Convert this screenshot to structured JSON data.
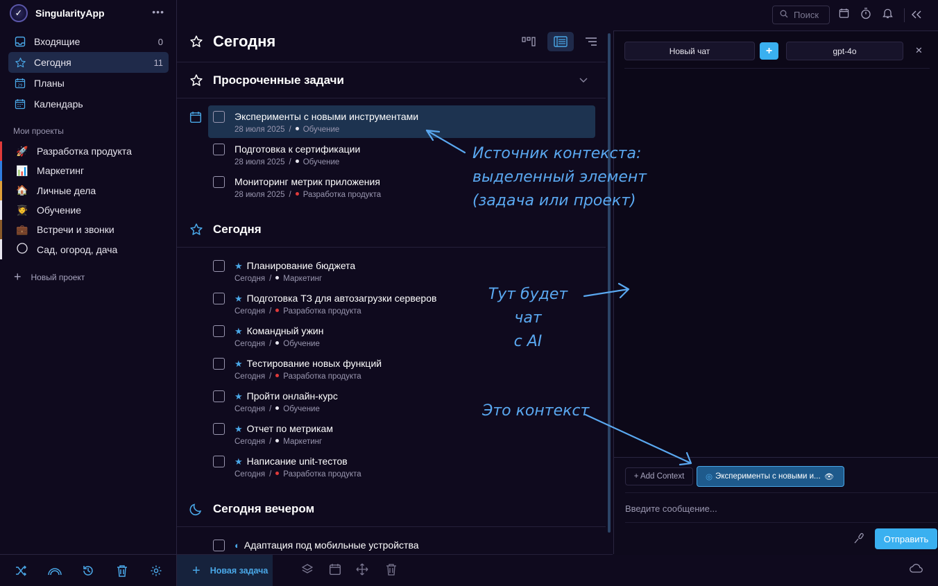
{
  "app": {
    "title": "SingularityApp",
    "more": "•••"
  },
  "nav": [
    {
      "label": "Входящие",
      "count": "0",
      "icon": "inbox-icon"
    },
    {
      "label": "Сегодня",
      "count": "11",
      "icon": "star-icon"
    },
    {
      "label": "Планы",
      "count": "",
      "icon": "plans-calendar-icon"
    },
    {
      "label": "Календарь",
      "count": "",
      "icon": "calendar-icon"
    }
  ],
  "projects_label": "Мои проекты",
  "projects": [
    {
      "label": "Разработка продукта",
      "emoji": "🚀",
      "color": "#e03a3a"
    },
    {
      "label": "Маркетинг",
      "emoji": "📊",
      "color": "#2f7de0"
    },
    {
      "label": "Личные дела",
      "emoji": "🏠",
      "color": "#e0a03a"
    },
    {
      "label": "Обучение",
      "emoji": "🧑‍🎓",
      "color": "#e8e6ef"
    },
    {
      "label": "Встречи и звонки",
      "emoji": "💼",
      "color": "#8a5a2a"
    },
    {
      "label": "Сад, огород, дача",
      "emoji": "◯",
      "color": "#e8e6ef"
    }
  ],
  "new_project": "Новый проект",
  "main": {
    "title": "Сегодня"
  },
  "groups": {
    "overdue": "Просроченные задачи",
    "today": "Сегодня",
    "evening": "Сегодня вечером"
  },
  "overdue_tasks": [
    {
      "title": "Эксперименты с новыми инструментами",
      "date": "28 июля 2025",
      "project": "Обучение",
      "dot": "#e8e6ef"
    },
    {
      "title": "Подготовка к сертификации",
      "date": "28 июля 2025",
      "project": "Обучение",
      "dot": "#e8e6ef"
    },
    {
      "title": "Мониторинг метрик приложения",
      "date": "28 июля 2025",
      "project": "Разработка продукта",
      "dot": "#e03a3a"
    }
  ],
  "today_tasks": [
    {
      "title": "Планирование бюджета",
      "date": "Сегодня",
      "project": "Маркетинг",
      "dot": "#e8e6ef"
    },
    {
      "title": "Подготовка ТЗ для автозагрузки серверов",
      "date": "Сегодня",
      "project": "Разработка продукта",
      "dot": "#e03a3a"
    },
    {
      "title": "Командный ужин",
      "date": "Сегодня",
      "project": "Обучение",
      "dot": "#e8e6ef"
    },
    {
      "title": "Тестирование новых функций",
      "date": "Сегодня",
      "project": "Разработка продукта",
      "dot": "#e03a3a"
    },
    {
      "title": "Пройти онлайн-курс",
      "date": "Сегодня",
      "project": "Обучение",
      "dot": "#e8e6ef"
    },
    {
      "title": "Отчет по метрикам",
      "date": "Сегодня",
      "project": "Маркетинг",
      "dot": "#e8e6ef"
    },
    {
      "title": "Написание unit-тестов",
      "date": "Сегодня",
      "project": "Разработка продукта",
      "dot": "#e03a3a"
    }
  ],
  "evening_tasks": [
    {
      "title": "Адаптация под мобильные устройства"
    }
  ],
  "new_task": "Новая задача",
  "search": {
    "placeholder": "Поиск"
  },
  "chat": {
    "new_chat": "Новый чат",
    "plus": "+",
    "model": "gpt-4o",
    "close": "✕",
    "add_context": "+ Add Context",
    "context_chip": "Эксперименты с новыми и...",
    "input_placeholder": "Введите сообщение...",
    "send": "Отправить"
  },
  "annotations": {
    "context_source": [
      "Источник контекста:",
      "выделенный элемент",
      "(задача или проект)"
    ],
    "chat_here": [
      "Тут будет чат",
      "с AI"
    ],
    "this_context": "Это контекст"
  },
  "colors": {
    "accent": "#3ab0f0",
    "background": "#0f0a1e",
    "selected": "#1d3350",
    "annotation": "#5aa8f0"
  }
}
